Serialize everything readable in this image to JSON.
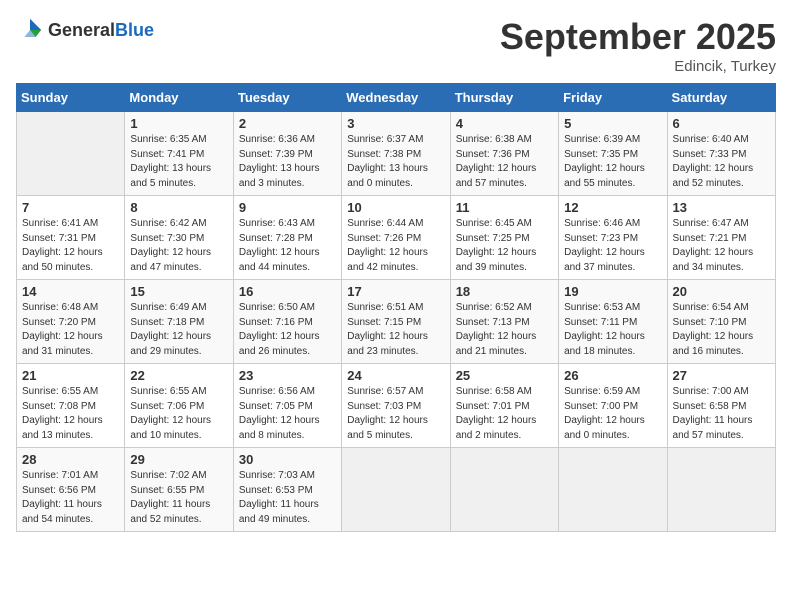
{
  "logo": {
    "general": "General",
    "blue": "Blue"
  },
  "title": "September 2025",
  "subtitle": "Edincik, Turkey",
  "days_of_week": [
    "Sunday",
    "Monday",
    "Tuesday",
    "Wednesday",
    "Thursday",
    "Friday",
    "Saturday"
  ],
  "weeks": [
    [
      {
        "day": "",
        "info": ""
      },
      {
        "day": "1",
        "info": "Sunrise: 6:35 AM\nSunset: 7:41 PM\nDaylight: 13 hours\nand 5 minutes."
      },
      {
        "day": "2",
        "info": "Sunrise: 6:36 AM\nSunset: 7:39 PM\nDaylight: 13 hours\nand 3 minutes."
      },
      {
        "day": "3",
        "info": "Sunrise: 6:37 AM\nSunset: 7:38 PM\nDaylight: 13 hours\nand 0 minutes."
      },
      {
        "day": "4",
        "info": "Sunrise: 6:38 AM\nSunset: 7:36 PM\nDaylight: 12 hours\nand 57 minutes."
      },
      {
        "day": "5",
        "info": "Sunrise: 6:39 AM\nSunset: 7:35 PM\nDaylight: 12 hours\nand 55 minutes."
      },
      {
        "day": "6",
        "info": "Sunrise: 6:40 AM\nSunset: 7:33 PM\nDaylight: 12 hours\nand 52 minutes."
      }
    ],
    [
      {
        "day": "7",
        "info": "Sunrise: 6:41 AM\nSunset: 7:31 PM\nDaylight: 12 hours\nand 50 minutes."
      },
      {
        "day": "8",
        "info": "Sunrise: 6:42 AM\nSunset: 7:30 PM\nDaylight: 12 hours\nand 47 minutes."
      },
      {
        "day": "9",
        "info": "Sunrise: 6:43 AM\nSunset: 7:28 PM\nDaylight: 12 hours\nand 44 minutes."
      },
      {
        "day": "10",
        "info": "Sunrise: 6:44 AM\nSunset: 7:26 PM\nDaylight: 12 hours\nand 42 minutes."
      },
      {
        "day": "11",
        "info": "Sunrise: 6:45 AM\nSunset: 7:25 PM\nDaylight: 12 hours\nand 39 minutes."
      },
      {
        "day": "12",
        "info": "Sunrise: 6:46 AM\nSunset: 7:23 PM\nDaylight: 12 hours\nand 37 minutes."
      },
      {
        "day": "13",
        "info": "Sunrise: 6:47 AM\nSunset: 7:21 PM\nDaylight: 12 hours\nand 34 minutes."
      }
    ],
    [
      {
        "day": "14",
        "info": "Sunrise: 6:48 AM\nSunset: 7:20 PM\nDaylight: 12 hours\nand 31 minutes."
      },
      {
        "day": "15",
        "info": "Sunrise: 6:49 AM\nSunset: 7:18 PM\nDaylight: 12 hours\nand 29 minutes."
      },
      {
        "day": "16",
        "info": "Sunrise: 6:50 AM\nSunset: 7:16 PM\nDaylight: 12 hours\nand 26 minutes."
      },
      {
        "day": "17",
        "info": "Sunrise: 6:51 AM\nSunset: 7:15 PM\nDaylight: 12 hours\nand 23 minutes."
      },
      {
        "day": "18",
        "info": "Sunrise: 6:52 AM\nSunset: 7:13 PM\nDaylight: 12 hours\nand 21 minutes."
      },
      {
        "day": "19",
        "info": "Sunrise: 6:53 AM\nSunset: 7:11 PM\nDaylight: 12 hours\nand 18 minutes."
      },
      {
        "day": "20",
        "info": "Sunrise: 6:54 AM\nSunset: 7:10 PM\nDaylight: 12 hours\nand 16 minutes."
      }
    ],
    [
      {
        "day": "21",
        "info": "Sunrise: 6:55 AM\nSunset: 7:08 PM\nDaylight: 12 hours\nand 13 minutes."
      },
      {
        "day": "22",
        "info": "Sunrise: 6:55 AM\nSunset: 7:06 PM\nDaylight: 12 hours\nand 10 minutes."
      },
      {
        "day": "23",
        "info": "Sunrise: 6:56 AM\nSunset: 7:05 PM\nDaylight: 12 hours\nand 8 minutes."
      },
      {
        "day": "24",
        "info": "Sunrise: 6:57 AM\nSunset: 7:03 PM\nDaylight: 12 hours\nand 5 minutes."
      },
      {
        "day": "25",
        "info": "Sunrise: 6:58 AM\nSunset: 7:01 PM\nDaylight: 12 hours\nand 2 minutes."
      },
      {
        "day": "26",
        "info": "Sunrise: 6:59 AM\nSunset: 7:00 PM\nDaylight: 12 hours\nand 0 minutes."
      },
      {
        "day": "27",
        "info": "Sunrise: 7:00 AM\nSunset: 6:58 PM\nDaylight: 11 hours\nand 57 minutes."
      }
    ],
    [
      {
        "day": "28",
        "info": "Sunrise: 7:01 AM\nSunset: 6:56 PM\nDaylight: 11 hours\nand 54 minutes."
      },
      {
        "day": "29",
        "info": "Sunrise: 7:02 AM\nSunset: 6:55 PM\nDaylight: 11 hours\nand 52 minutes."
      },
      {
        "day": "30",
        "info": "Sunrise: 7:03 AM\nSunset: 6:53 PM\nDaylight: 11 hours\nand 49 minutes."
      },
      {
        "day": "",
        "info": ""
      },
      {
        "day": "",
        "info": ""
      },
      {
        "day": "",
        "info": ""
      },
      {
        "day": "",
        "info": ""
      }
    ]
  ]
}
